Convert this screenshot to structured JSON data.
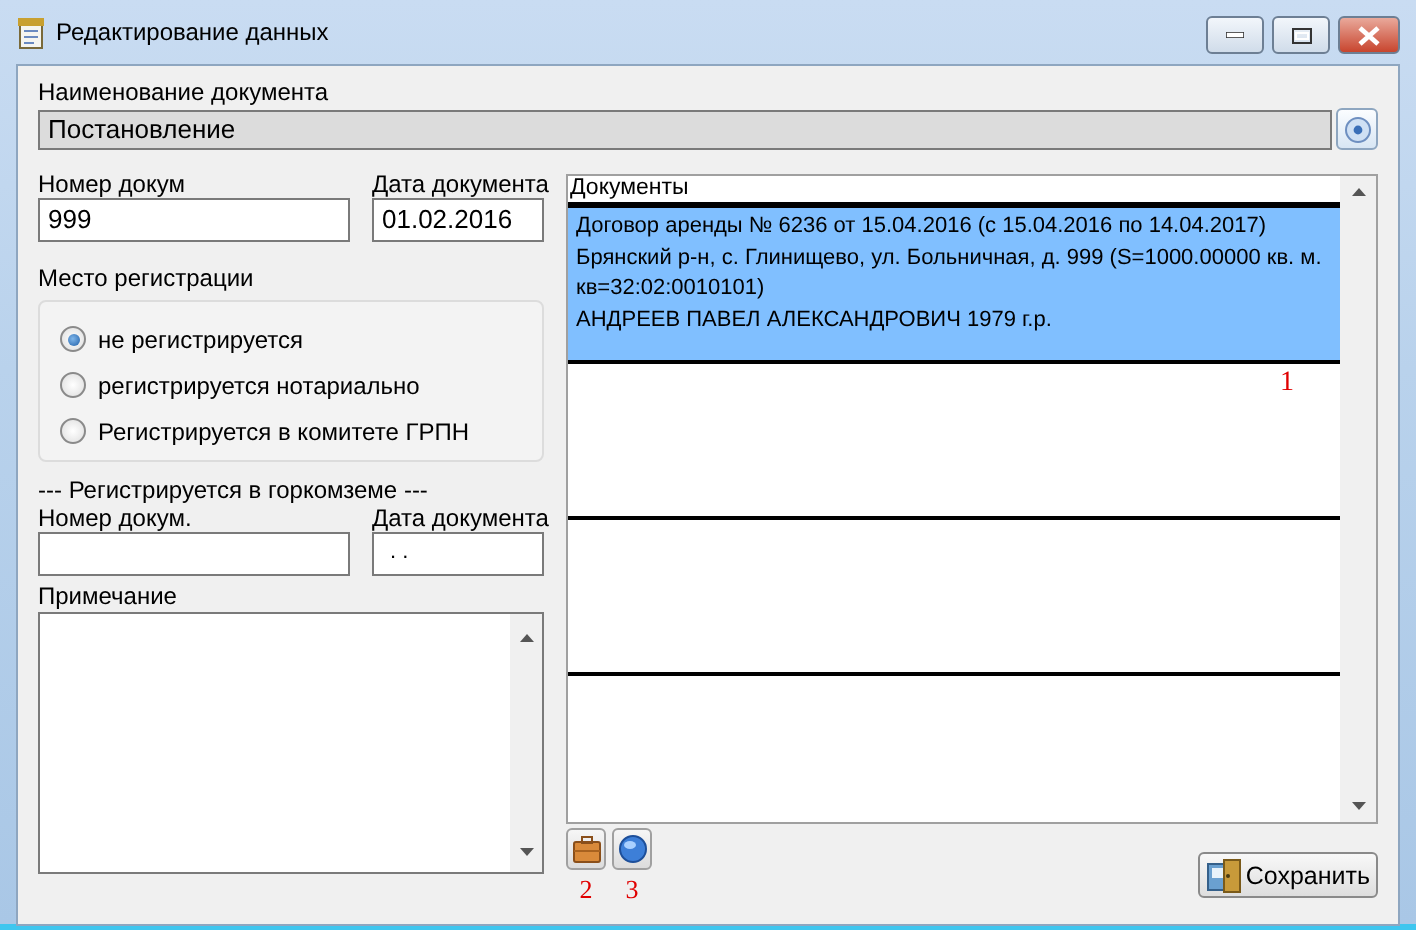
{
  "window": {
    "title": "Редактирование данных"
  },
  "document_name": {
    "label": "Наименование документа",
    "value": "Постановление"
  },
  "doc_number": {
    "label": "Номер докум",
    "value": "999"
  },
  "doc_date": {
    "label": "Дата документа",
    "value": "01.02.2016"
  },
  "registration": {
    "label": "Место регистрации",
    "options": [
      {
        "label": "не регистрируется",
        "selected": true
      },
      {
        "label": "регистрируется нотариально",
        "selected": false
      },
      {
        "label": "Регистрируется в комитете ГРПН",
        "selected": false
      }
    ]
  },
  "gorkomzem": {
    "heading": "--- Регистрируется в горкомземе ---",
    "number": {
      "label": "Номер докум."
    },
    "date": {
      "label": "Дата документа",
      "value": ". ."
    }
  },
  "note": {
    "label": "Примечание"
  },
  "documents": {
    "label": "Документы",
    "annotation": "1",
    "rows": [
      {
        "selected": true,
        "lines": [
          "Договор аренды № 6236 от 15.04.2016 (с 15.04.2016 по 14.04.2017)",
          "Брянский р-н, с. Глинищево, ул. Больничная, д. 999 (S=1000.00000 кв. м.",
          "кв=32:02:0010101)",
          "АНДРЕЕВ ПАВЕЛ АЛЕКСАНДРОВИЧ 1979 г.р."
        ]
      },
      {
        "selected": false
      },
      {
        "selected": false
      },
      {
        "selected": false
      }
    ]
  },
  "tool_buttons": [
    {
      "kind": "briefcase",
      "annotation": "2"
    },
    {
      "kind": "globe",
      "annotation": "3"
    }
  ],
  "save_button": {
    "label": "Сохранить"
  }
}
